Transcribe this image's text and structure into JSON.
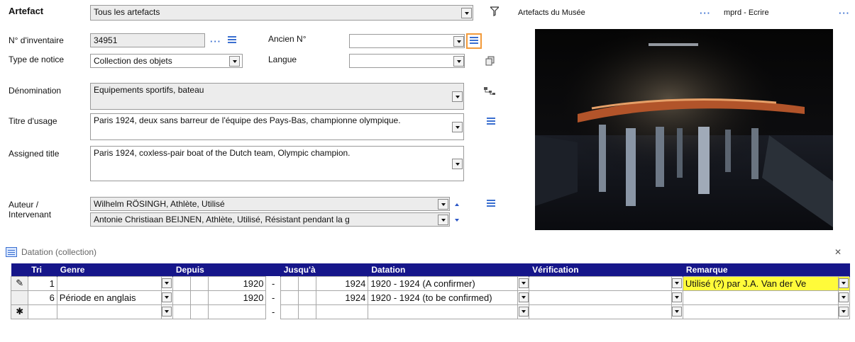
{
  "header": {
    "artefact_label": "Artefact",
    "artefact_value": "Tous les artefacts",
    "collection_label": "Artefacts du Musée",
    "mode_label": "mprd - Ecrire",
    "dots": "···"
  },
  "fields": {
    "inventaire_label": "N° d'inventaire",
    "inventaire_value": "34951",
    "ancien_label": "Ancien N°",
    "ancien_value": "",
    "type_label": "Type de notice",
    "type_value": "Collection des objets",
    "langue_label": "Langue",
    "langue_value": "",
    "denomination_label": "Dénomination",
    "denomination_value": "Equipements sportifs, bateau",
    "titre_label": "Titre d'usage",
    "titre_value": "Paris 1924, deux sans barreur de l'équipe des Pays-Bas, championne olympique.",
    "assigned_label": "Assigned title",
    "assigned_value": "Paris 1924, coxless-pair boat of the Dutch team, Olympic champion.",
    "auteur_label_1": "Auteur /",
    "auteur_label_2": "Intervenant",
    "auteur_1": "Wilhelm RÖSINGH, Athlète, Utilisé",
    "auteur_2": "Antonie Christiaan BEIJNEN, Athlète, Utilisé, Résistant pendant la g"
  },
  "datation": {
    "panel_title": "Datation (collection)",
    "close_glyph": "✕",
    "columns": [
      "Tri",
      "Genre",
      "Depuis",
      "Jusqu'à",
      "Datation",
      "Vérification",
      "Remarque"
    ],
    "rows": [
      {
        "marker": "✎",
        "tri": "1",
        "genre": "",
        "depuis": "1920",
        "sep": "-",
        "jusqua": "1924",
        "datation": "1920 - 1924 (A confirmer)",
        "verification": "",
        "remarque": "Utilisé (?) par J.A. Van der Ve"
      },
      {
        "marker": "",
        "tri": "6",
        "genre": "Période en anglais",
        "depuis": "1920",
        "sep": "-",
        "jusqua": "1924",
        "datation": "1920 - 1924 (to be confirmed)",
        "verification": "",
        "remarque": ""
      },
      {
        "marker": "✱",
        "tri": "",
        "genre": "",
        "depuis": "",
        "sep": "-",
        "jusqua": "",
        "datation": "",
        "verification": "",
        "remarque": ""
      }
    ]
  },
  "colors": {
    "header_bg": "#16168a",
    "highlight": "#fffb3a",
    "accent_blue": "#3a6fd0"
  }
}
